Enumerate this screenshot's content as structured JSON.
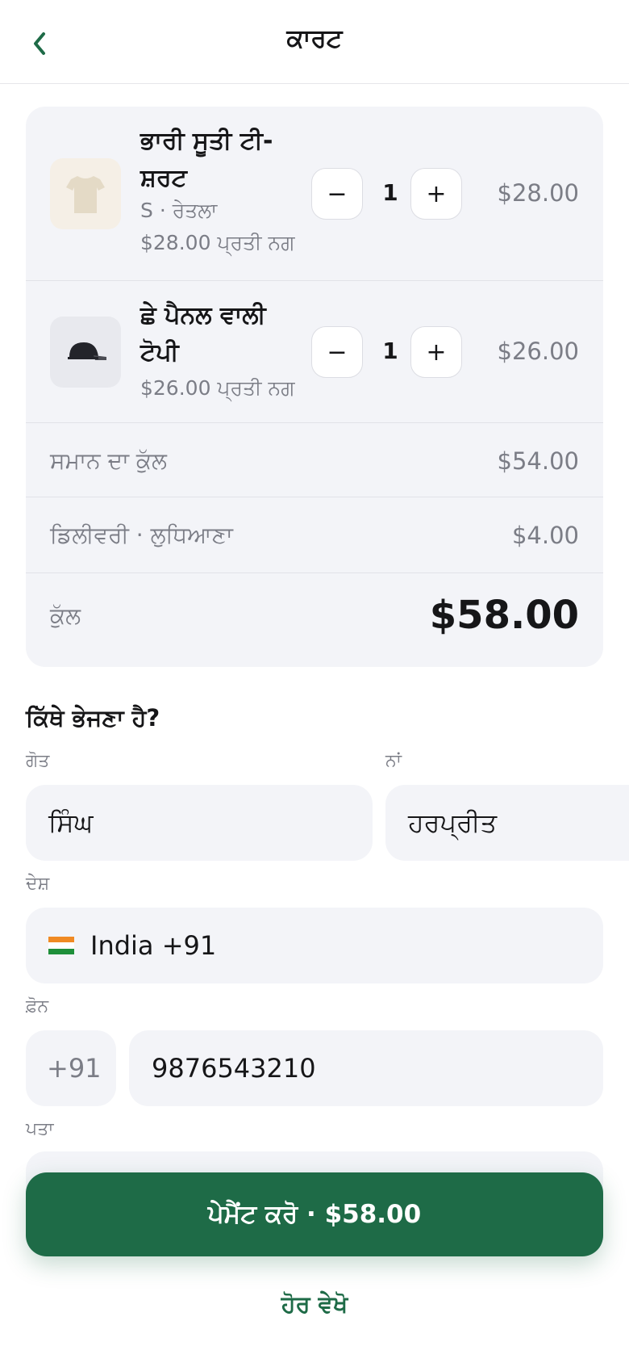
{
  "header": {
    "back_icon": "chevron-left-icon",
    "title": "ਕਾਰਟ"
  },
  "cart": {
    "items": [
      {
        "name": "ਭਾਰੀ ਸੂਤੀ ਟੀ-ਸ਼ਰਟ",
        "variant": "S · ਰੇਤਲਾ",
        "unit_price": "$28.00 ਪ੍ਰਤੀ ਨਗ",
        "quantity": "1",
        "price": "$28.00",
        "icon": "tshirt-icon"
      },
      {
        "name": "ਛੇ ਪੈਨਲ ਵਾਲੀ ਟੋਪੀ",
        "unit_price": "$26.00 ਪ੍ਰਤੀ ਨਗ",
        "quantity": "1",
        "price": "$26.00",
        "icon": "cap-icon"
      }
    ],
    "decrement_symbol": "−",
    "increment_symbol": "+",
    "subtotal_label": "ਸਮਾਨ ਦਾ ਕੁੱਲ",
    "subtotal_value": "$54.00",
    "delivery_label": "ਡਿਲੀਵਰੀ · ਲੁਧਿਆਣਾ",
    "delivery_value": "$4.00",
    "total_label": "ਕੁੱਲ",
    "total_value": "$58.00"
  },
  "shipping": {
    "title": "ਕਿੱਥੇ ਭੇਜਣਾ ਹੈ?",
    "surname_label": "ਗੋਤ",
    "surname_value": "ਸਿੰਘ",
    "first_name_label": "ਨਾਂ",
    "first_name_value": "ਹਰਪ੍ਰੀਤ",
    "country_label": "ਦੇਸ਼",
    "country_value": "India +91",
    "country_flag": "india-flag-icon",
    "phone_label": "ਫ਼ੋਨ",
    "phone_code": "+91",
    "phone_value": "9876543210",
    "address_label": "ਪਤਾ"
  },
  "actions": {
    "pay_label": "ਪੇਮੈਂਟ ਕਰੋ · $58.00",
    "more_label": "ਹੋਰ ਵੇਖੋ"
  },
  "colors": {
    "accent": "#1e6b47",
    "card_bg": "#f3f4f8",
    "muted_text": "#7b7d86"
  }
}
